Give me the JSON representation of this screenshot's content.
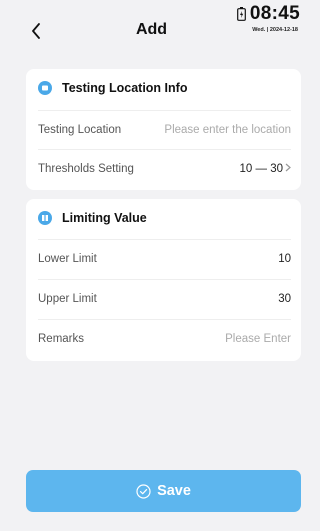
{
  "header": {
    "title": "Add",
    "time": "08:45",
    "date": "Wed. | 2024-12-18"
  },
  "location_section": {
    "title": "Testing Location Info",
    "location_label": "Testing Location",
    "location_placeholder": "Please enter the location",
    "thresholds_label": "Thresholds Setting",
    "thresholds_value": "10 — 30"
  },
  "limit_section": {
    "title": "Limiting Value",
    "lower_label": "Lower Limit",
    "lower_value": "10",
    "upper_label": "Upper Limit",
    "upper_value": "30",
    "remarks_label": "Remarks",
    "remarks_placeholder": "Please Enter"
  },
  "save_label": "Save",
  "colors": {
    "accent": "#4aa8e8",
    "save_button": "#5db6ee",
    "background": "#f2f2f4"
  }
}
